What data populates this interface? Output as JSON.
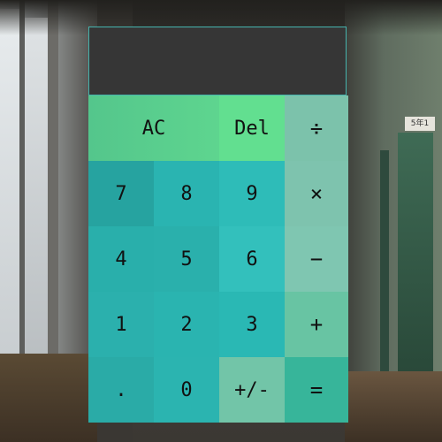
{
  "display": {
    "value": ""
  },
  "keys": {
    "ac": "AC",
    "del": "Del",
    "divide": "÷",
    "seven": "7",
    "eight": "8",
    "nine": "9",
    "multiply": "×",
    "four": "4",
    "five": "5",
    "six": "6",
    "subtract": "−",
    "one": "1",
    "two": "2",
    "three": "3",
    "add": "+",
    "dot": ".",
    "zero": "0",
    "negate": "+/-",
    "equals": "="
  },
  "background": {
    "sign": "5年1"
  },
  "colors": {
    "display_bg": "#363636",
    "display_border": "#45b3ad",
    "key_green": "#5fd88f",
    "key_teal": "#2eb5b0",
    "key_operator": "#7ec3ae"
  }
}
